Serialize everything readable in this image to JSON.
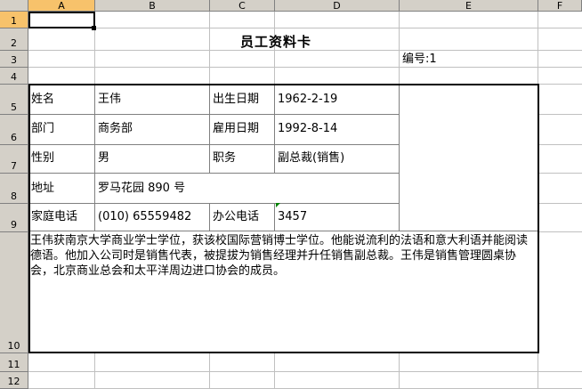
{
  "columns": [
    "A",
    "B",
    "C",
    "D",
    "E",
    "F"
  ],
  "rows": [
    "1",
    "2",
    "3",
    "4",
    "5",
    "6",
    "7",
    "8",
    "9",
    "10",
    "11",
    "12"
  ],
  "title": "员工资料卡",
  "serial": "编号:1",
  "card": {
    "name_label": "姓名",
    "name_value": "王伟",
    "birth_label": "出生日期",
    "birth_value": "1962-2-19",
    "dept_label": "部门",
    "dept_value": "商务部",
    "hire_label": "雇用日期",
    "hire_value": "1992-8-14",
    "gender_label": "性别",
    "gender_value": "男",
    "title_label": "职务",
    "title_value": "副总裁(销售)",
    "address_label": "地址",
    "address_value": "罗马花园 890 号",
    "home_phone_label": "家庭电话",
    "home_phone_value": "(010) 65559482",
    "office_phone_label": "办公电话",
    "office_phone_value": "3457",
    "notes": "王伟获南京大学商业学士学位，获该校国际营销博士学位。他能说流利的法语和意大利语并能阅读德语。他加入公司时是销售代表，被提拔为销售经理并升任销售副总裁。王伟是销售管理圆桌协会，北京商业总会和太平洋周边进口协会的成员。"
  }
}
